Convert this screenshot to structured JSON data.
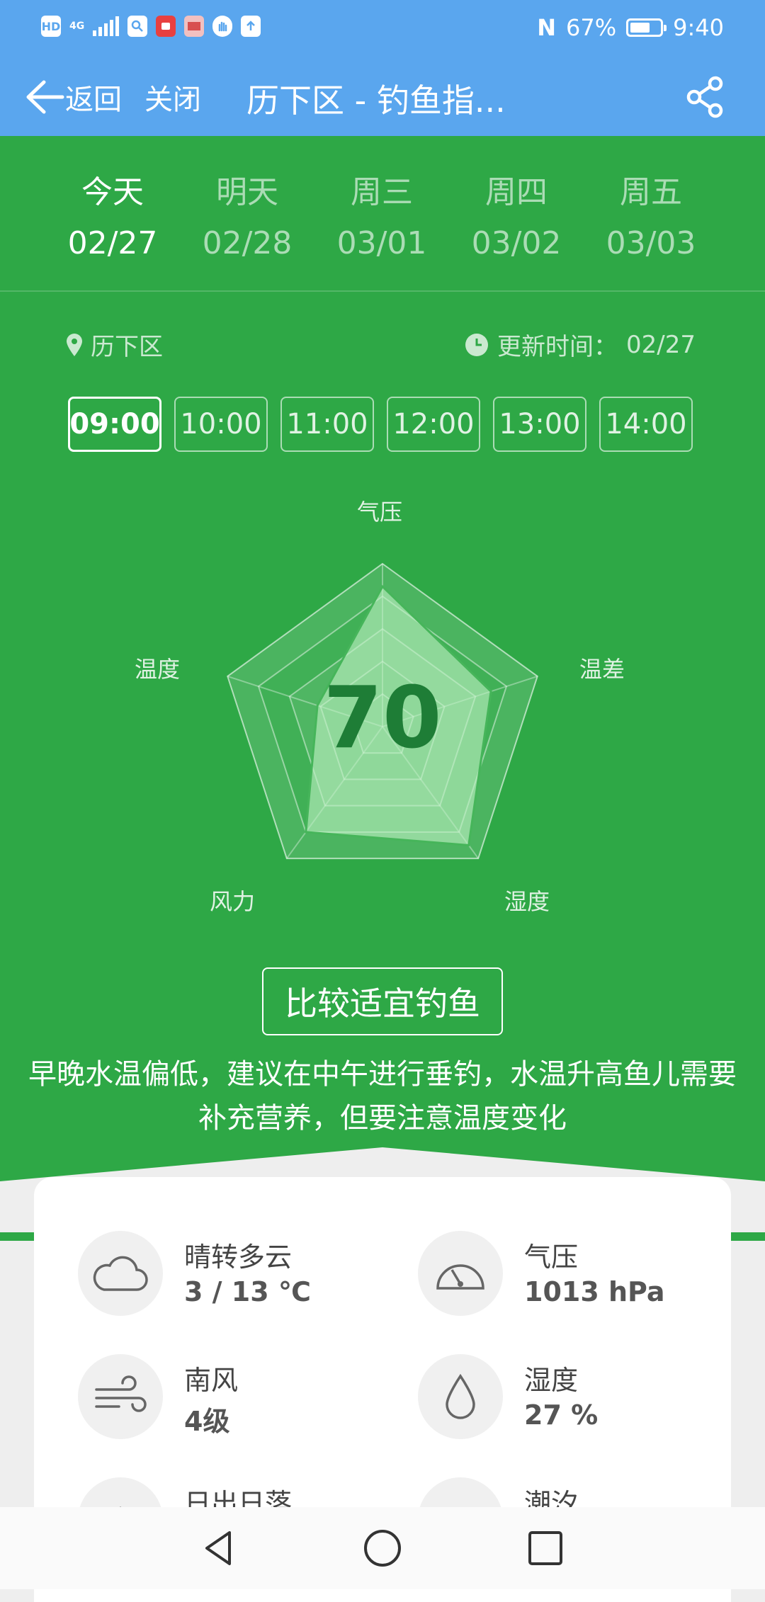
{
  "status_bar": {
    "network_badge": "HD",
    "network_type": "4G",
    "notification_icons": [
      "search-app-icon",
      "red-app-icon",
      "book-app-icon",
      "hand-app-icon",
      "upload-app-icon"
    ],
    "nfc_label": "N",
    "battery": "67%",
    "battery_level": 0.67,
    "time": "9:40"
  },
  "toolbar": {
    "back_label": "返回",
    "close_label": "关闭",
    "title": "历下区 - 钓鱼指..."
  },
  "days": [
    {
      "name": "今天",
      "date": "02/27",
      "active": true
    },
    {
      "name": "明天",
      "date": "02/28",
      "active": false
    },
    {
      "name": "周三",
      "date": "03/01",
      "active": false
    },
    {
      "name": "周四",
      "date": "03/02",
      "active": false
    },
    {
      "name": "周五",
      "date": "03/03",
      "active": false
    }
  ],
  "location": "历下区",
  "update": {
    "label": "更新时间：",
    "value": "02/27"
  },
  "hours": [
    {
      "label": "09:00",
      "active": true
    },
    {
      "label": "10:00",
      "active": false
    },
    {
      "label": "11:00",
      "active": false
    },
    {
      "label": "12:00",
      "active": false
    },
    {
      "label": "13:00",
      "active": false
    },
    {
      "label": "14:00",
      "active": false
    }
  ],
  "chart_data": {
    "type": "radar",
    "axes": [
      "气压",
      "温差",
      "湿度",
      "风力",
      "温度"
    ],
    "scale_max": 100,
    "values": [
      86,
      70,
      90,
      80,
      42
    ],
    "center_value": "70"
  },
  "verdict": "比较适宜钓鱼",
  "advice": "早晚水温偏低，建议在中午进行垂钓，水温升高鱼儿需要补充营养，但要注意温度变化",
  "info": [
    {
      "icon": "cloud-icon",
      "label": "晴转多云",
      "value": "3 / 13 ℃"
    },
    {
      "icon": "gauge-icon",
      "label": "气压",
      "value": "1013 hPa"
    },
    {
      "icon": "wind-icon",
      "label": "南风",
      "value": "4级"
    },
    {
      "icon": "droplet-icon",
      "label": "湿度",
      "value": "27 %"
    },
    {
      "icon": "sunrise-icon",
      "label": "日出日落",
      "value": ""
    },
    {
      "icon": "tide-icon",
      "label": "潮汐",
      "value": ""
    }
  ],
  "colors": {
    "bar_blue": "#5aa6ee",
    "panel_green": "#2ea846",
    "score_green": "#1e7d36"
  }
}
